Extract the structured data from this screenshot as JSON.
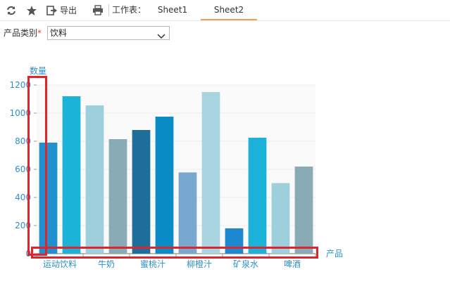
{
  "toolbar": {
    "refresh_icon": "refresh-icon",
    "favorite_icon": "star-icon",
    "export_icon": "export-icon",
    "export_label": "导出",
    "print_icon": "print-icon",
    "worksheet_label": "工作表：",
    "tabs": [
      {
        "label": "Sheet1",
        "active": false
      },
      {
        "label": "Sheet2",
        "active": true
      }
    ]
  },
  "filter": {
    "label": "产品类别",
    "required_mark": "*",
    "selected": "饮料"
  },
  "colors": {
    "axis_text": "#2e8fc7",
    "active_tab": "#f0a050",
    "highlight_box": "#e0242c",
    "bars": [
      "#1f91d1",
      "#1cb3d9",
      "#9dd0dc",
      "#88abb6",
      "#1e6e9b",
      "#0a8cc6",
      "#78a8cf",
      "#a8d5e0",
      "#1b88d0",
      "#1bb1d8",
      "#9dd0dc",
      "#88abb6"
    ]
  },
  "chart_data": {
    "type": "bar",
    "ylabel": "数量",
    "xlabel": "产品",
    "ylim": [
      0,
      1200
    ],
    "yticks": [
      0,
      200,
      400,
      600,
      800,
      1000,
      1200
    ],
    "grid": true,
    "categories": [
      "运动饮料",
      "",
      "牛奶",
      "",
      "蜜桃汁",
      "",
      "柳橙汁",
      "",
      "矿泉水",
      "",
      "啤酒",
      ""
    ],
    "values": [
      790,
      1120,
      1055,
      815,
      880,
      975,
      578,
      1150,
      180,
      825,
      502,
      620
    ]
  }
}
